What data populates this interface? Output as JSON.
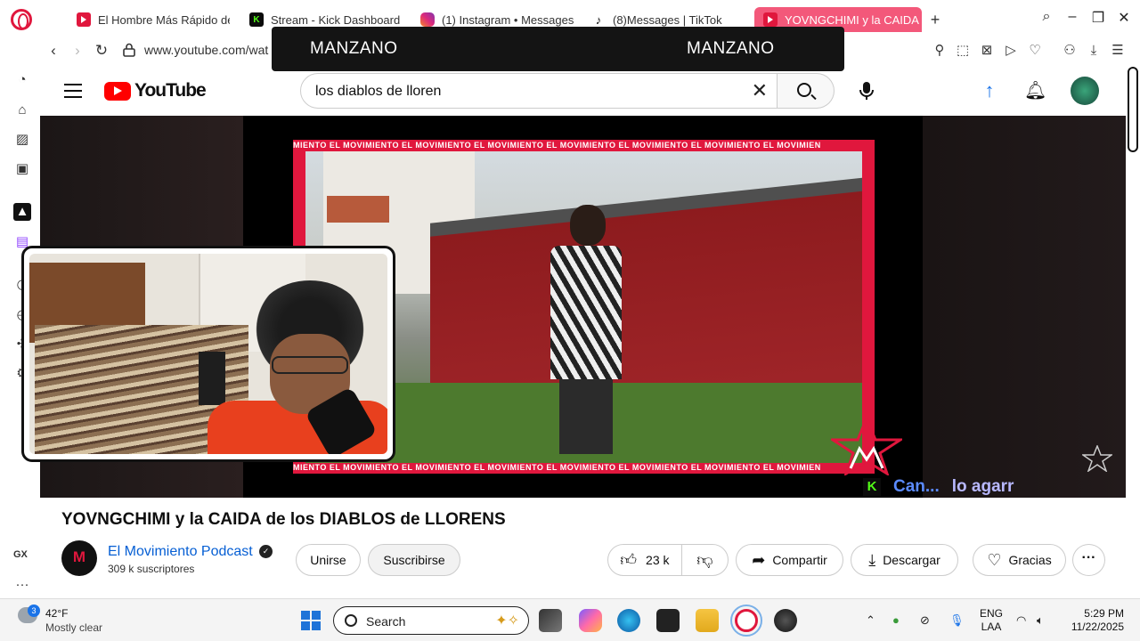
{
  "tabs": [
    {
      "label": "El Hombre Más Rápido de",
      "icon": "youtube-icon"
    },
    {
      "label": "Stream - Kick Dashboard",
      "icon": "kick-icon"
    },
    {
      "label": "(1) Instagram • Messages",
      "icon": "instagram-icon"
    },
    {
      "label": "(8)Messages | TikTok",
      "icon": "tiktok-icon"
    },
    {
      "label": "YOVNGCHIMI y la CAIDA d",
      "icon": "youtube-icon",
      "active": true
    }
  ],
  "address": {
    "url": "www.youtube.com/wat"
  },
  "banner": {
    "left": "MANZANO",
    "right": "MANZANO"
  },
  "youtube": {
    "logo_text": "YouTube",
    "search_query": "los diablos de lloren"
  },
  "video": {
    "frame_text": "MIENTO  EL MOVIMIENTO  EL MOVIMIENTO  EL MOVIMIENTO  EL MOVIMIENTO  EL MOVIMIENTO  EL MOVIMIENTO  EL MOVIMIEN",
    "caption_part1": "Can...",
    "caption_part2": "lo agarr",
    "kick_badge": "K"
  },
  "meta": {
    "title": "YOVNGCHIMI y la CAIDA de los DIABLOS de LLORENS",
    "channel_name": "El Movimiento Podcast",
    "subscribers": "309 k suscriptores",
    "join_label": "Unirse",
    "subscribe_label": "Suscribirse",
    "likes": "23 k",
    "share_label": "Compartir",
    "download_label": "Descargar",
    "thanks_label": "Gracias"
  },
  "sidebar": {
    "gx_label": "GX"
  },
  "taskbar": {
    "weather_badge": "3",
    "temperature": "42°F",
    "condition": "Mostly clear",
    "search_label": "Search",
    "lang_line1": "ENG",
    "lang_line2": "LAA",
    "time": "5:29 PM",
    "date": "11/22/2025"
  },
  "colors": {
    "accent": "#e0173d",
    "youtube_red": "#ff0000",
    "link_blue": "#065fd4"
  }
}
